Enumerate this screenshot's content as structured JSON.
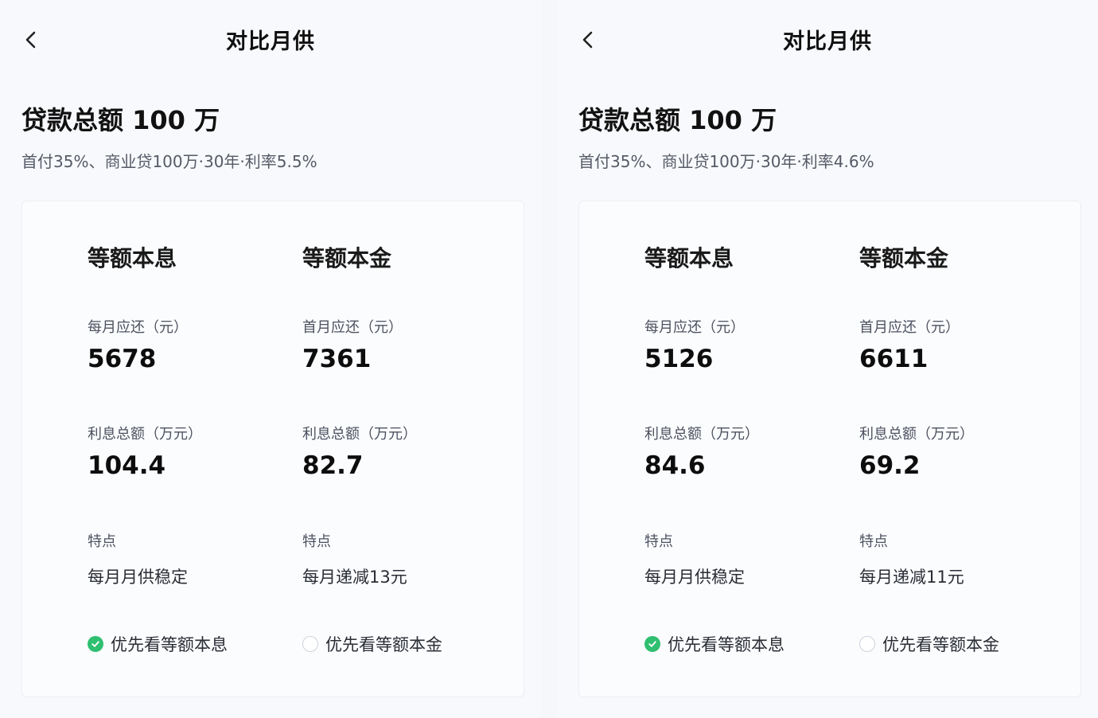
{
  "colors": {
    "accent_green": "#2fbf71",
    "text_primary": "#111111",
    "text_secondary": "#555a66",
    "background": "#f8f9fc"
  },
  "panels": [
    {
      "nav": {
        "back_icon": "chevron-left-icon",
        "title": "对比月供"
      },
      "loan": {
        "title": "贷款总额 100 万",
        "subtitle": "首付35%、商业贷100万·30年·利率5.5%"
      },
      "methods": [
        {
          "name": "等额本息",
          "monthly_label": "每月应还（元）",
          "monthly_value": "5678",
          "interest_label": "利息总额（万元）",
          "interest_value": "104.4",
          "feature_label": "特点",
          "feature_text": "每月月供稳定",
          "choice_label": "优先看等额本息",
          "choice_selected": true
        },
        {
          "name": "等额本金",
          "monthly_label": "首月应还（元）",
          "monthly_value": "7361",
          "interest_label": "利息总额（万元）",
          "interest_value": "82.7",
          "feature_label": "特点",
          "feature_text": "每月递减13元",
          "choice_label": "优先看等额本金",
          "choice_selected": false
        }
      ]
    },
    {
      "nav": {
        "back_icon": "chevron-left-icon",
        "title": "对比月供"
      },
      "loan": {
        "title": "贷款总额 100 万",
        "subtitle": "首付35%、商业贷100万·30年·利率4.6%"
      },
      "methods": [
        {
          "name": "等额本息",
          "monthly_label": "每月应还（元）",
          "monthly_value": "5126",
          "interest_label": "利息总额（万元）",
          "interest_value": "84.6",
          "feature_label": "特点",
          "feature_text": "每月月供稳定",
          "choice_label": "优先看等额本息",
          "choice_selected": true
        },
        {
          "name": "等额本金",
          "monthly_label": "首月应还（元）",
          "monthly_value": "6611",
          "interest_label": "利息总额（万元）",
          "interest_value": "69.2",
          "feature_label": "特点",
          "feature_text": "每月递减11元",
          "choice_label": "优先看等额本金",
          "choice_selected": false
        }
      ]
    }
  ]
}
